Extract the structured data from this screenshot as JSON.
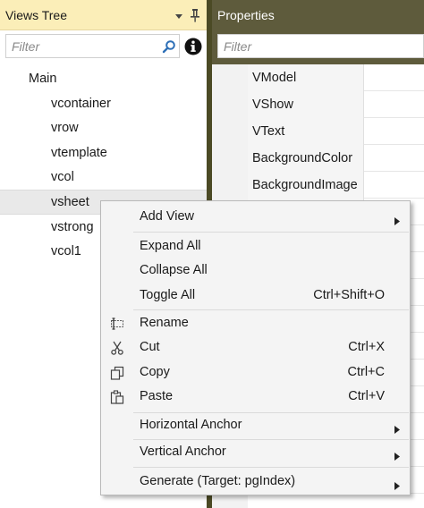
{
  "views_tree": {
    "title": "Views Tree",
    "filter_placeholder": "Filter",
    "items": [
      {
        "label": "Main"
      },
      {
        "label": "vcontainer"
      },
      {
        "label": "vrow"
      },
      {
        "label": "vtemplate"
      },
      {
        "label": "vcol"
      },
      {
        "label": "vsheet"
      },
      {
        "label": "vstrong"
      },
      {
        "label": "vcol1"
      }
    ],
    "selected_item": "vsheet"
  },
  "properties": {
    "title": "Properties",
    "filter_placeholder": "Filter",
    "rows": [
      {
        "name": "VModel",
        "value": ""
      },
      {
        "name": "VShow",
        "value": ""
      },
      {
        "name": "VText",
        "value": ""
      },
      {
        "name": "BackgroundColor",
        "value": ""
      },
      {
        "name": "BackgroundImage",
        "value": ""
      },
      {
        "name": "",
        "value": ""
      },
      {
        "name": "",
        "value": ""
      },
      {
        "name": "",
        "value": ""
      },
      {
        "name": "",
        "value": ""
      },
      {
        "name": "",
        "value": ""
      },
      {
        "name": "",
        "value": ""
      },
      {
        "name": "",
        "value": ""
      },
      {
        "name": "",
        "value": ""
      },
      {
        "name": "",
        "value": ""
      },
      {
        "name": "",
        "value": ""
      },
      {
        "name": "",
        "value": ""
      }
    ]
  },
  "context_menu": {
    "add_view": "Add View",
    "expand_all": "Expand All",
    "collapse_all": "Collapse All",
    "toggle_all": "Toggle All",
    "toggle_all_shortcut": "Ctrl+Shift+O",
    "rename": "Rename",
    "cut": "Cut",
    "cut_shortcut": "Ctrl+X",
    "copy": "Copy",
    "copy_shortcut": "Ctrl+C",
    "paste": "Paste",
    "paste_shortcut": "Ctrl+V",
    "horizontal_anchor": "Horizontal Anchor",
    "vertical_anchor": "Vertical Anchor",
    "generate": "Generate (Target: pgIndex)"
  },
  "icons": {
    "tree_dropdown": "chevron-down-icon",
    "tree_pin": "pin-icon",
    "search": "search-icon",
    "info": "info-icon",
    "rename": "rename-icon",
    "cut": "scissors-icon",
    "copy": "copy-icon",
    "paste": "paste-icon",
    "submenu": "chevron-right-icon"
  },
  "colors": {
    "tree_header_bg": "#fbeeb8",
    "properties_header_bg": "#5e5b3c",
    "search_icon": "#2d6fb7",
    "selection_bg": "#e9e9e9",
    "menu_bg": "#f4f4f4"
  }
}
